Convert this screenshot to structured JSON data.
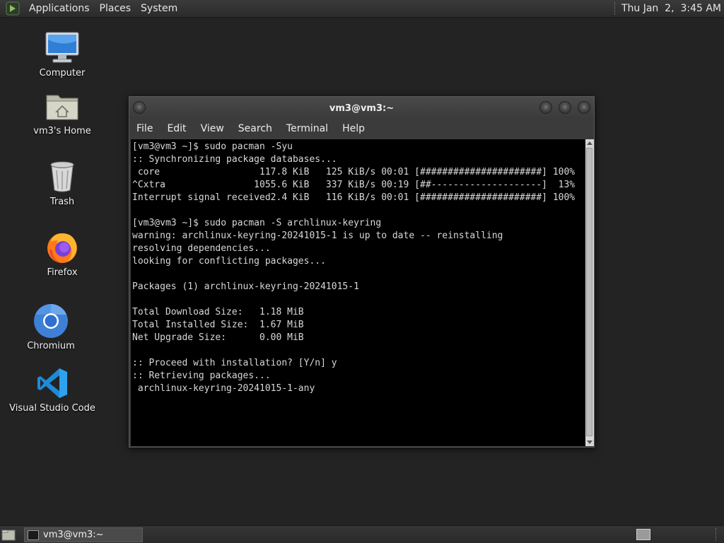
{
  "top_panel": {
    "menus": [
      "Applications",
      "Places",
      "System"
    ],
    "clock": "Thu Jan  2,  3:45 AM"
  },
  "desktop_icons": [
    {
      "label": "Computer",
      "icon": "computer-icon"
    },
    {
      "label": "vm3's Home",
      "icon": "home-folder-icon"
    },
    {
      "label": "Trash",
      "icon": "trash-icon"
    },
    {
      "label": "Firefox",
      "icon": "firefox-icon"
    },
    {
      "label": "Chromium",
      "icon": "chromium-icon"
    },
    {
      "label": "Visual Studio Code",
      "icon": "vscode-icon"
    }
  ],
  "terminal": {
    "title": "vm3@vm3:~",
    "menu": [
      "File",
      "Edit",
      "View",
      "Search",
      "Terminal",
      "Help"
    ],
    "lines": [
      "[vm3@vm3 ~]$ sudo pacman -Syu",
      ":: Synchronizing package databases...",
      " core                  117.8 KiB   125 KiB/s 00:01 [######################] 100%",
      "^Cxtra                1055.6 KiB   337 KiB/s 00:19 [##--------------------]  13%",
      "Interrupt signal received2.4 KiB   116 KiB/s 00:01 [######################] 100%",
      "",
      "[vm3@vm3 ~]$ sudo pacman -S archlinux-keyring",
      "warning: archlinux-keyring-20241015-1 is up to date -- reinstalling",
      "resolving dependencies...",
      "looking for conflicting packages...",
      "",
      "Packages (1) archlinux-keyring-20241015-1",
      "",
      "Total Download Size:   1.18 MiB",
      "Total Installed Size:  1.67 MiB",
      "Net Upgrade Size:      0.00 MiB",
      "",
      ":: Proceed with installation? [Y/n] y",
      ":: Retrieving packages...",
      " archlinux-keyring-20241015-1-any"
    ]
  },
  "taskbar": {
    "window_button": "vm3@vm3:~"
  }
}
